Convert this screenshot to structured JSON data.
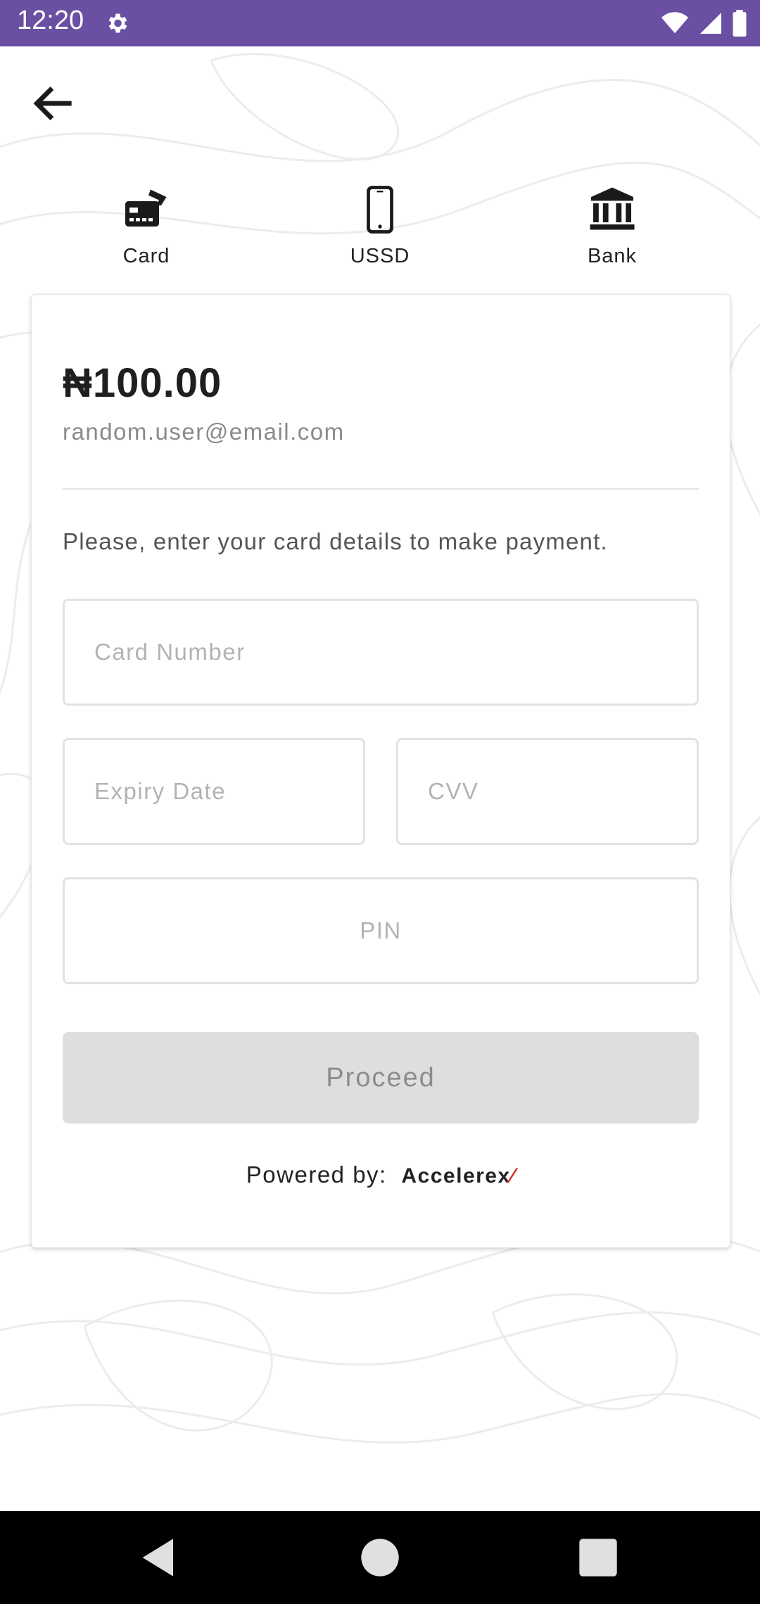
{
  "status_bar": {
    "time": "12:20"
  },
  "payment_tabs": [
    {
      "label": "Card",
      "icon": "card-icon"
    },
    {
      "label": "USSD",
      "icon": "phone-icon"
    },
    {
      "label": "Bank",
      "icon": "bank-icon"
    }
  ],
  "payment": {
    "amount": "₦100.00",
    "email": "random.user@email.com",
    "instruction": "Please, enter your card details to make payment."
  },
  "form": {
    "card_number_placeholder": "Card Number",
    "expiry_placeholder": "Expiry Date",
    "cvv_placeholder": "CVV",
    "pin_placeholder": "PIN",
    "proceed_label": "Proceed"
  },
  "footer": {
    "powered_by": "Powered by:",
    "brand": "Accelerex"
  },
  "colors": {
    "status_bar": "#6a4fa3",
    "button_disabled": "#dedede"
  }
}
